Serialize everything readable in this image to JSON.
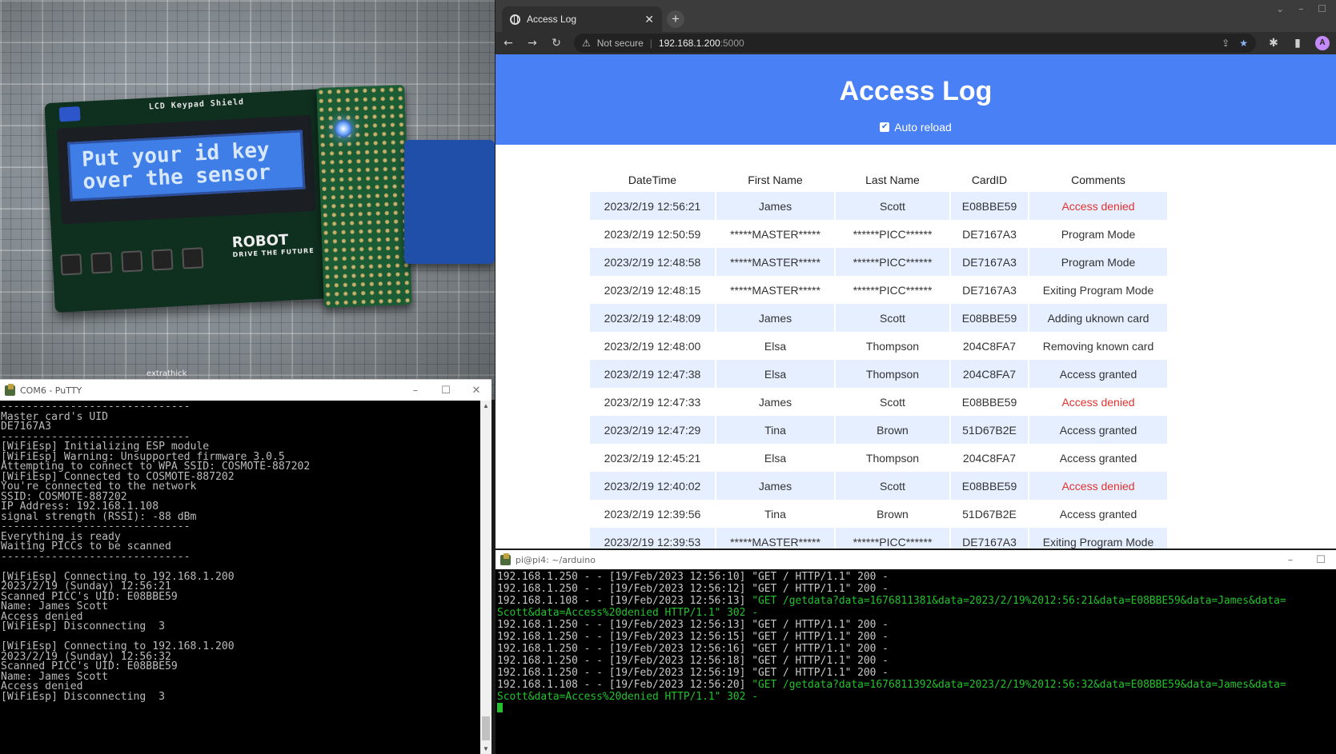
{
  "photo": {
    "lcd_text": "Put your id key\nover the sensor",
    "shield_label": "LCD Keypad Shield",
    "logo_text": "ROBOT",
    "logo_sub": "DRIVE THE FUTURE",
    "caption": "extrathick"
  },
  "putty": {
    "title": "COM6 - PuTTY",
    "controls": {
      "minimize": "–",
      "maximize": "☐",
      "close": "✕"
    },
    "lines": [
      "------------------------------",
      "Master card's UID",
      "DE7167A3",
      "------------------------------",
      "[WiFiEsp] Initializing ESP module",
      "[WiFiEsp] Warning: Unsupported firmware 3.0.5",
      "Attempting to connect to WPA SSID: COSMOTE-887202",
      "[WiFiEsp] Connected to COSMOTE-887202",
      "You're connected to the network",
      "SSID: COSMOTE-887202",
      "IP Address: 192.168.1.108",
      "signal strength (RSSI): -88 dBm",
      "------------------------------",
      "Everything is ready",
      "Waiting PICCs to be scanned",
      "------------------------------",
      "",
      "[WiFiEsp] Connecting to 192.168.1.200",
      "2023/2/19 (Sunday) 12:56:21",
      "Scanned PICC's UID: E08BBE59",
      "Name: James Scott",
      "Access denied",
      "[WiFiEsp] Disconnecting  3",
      "",
      "[WiFiEsp] Connecting to 192.168.1.200",
      "2023/2/19 (Sunday) 12:56:32",
      "Scanned PICC's UID: E08BBE59",
      "Name: James Scott",
      "Access denied",
      "[WiFiEsp] Disconnecting  3"
    ]
  },
  "browser": {
    "tab_title": "Access Log",
    "tab_close": "✕",
    "new_tab": "+",
    "security_label": "Not secure",
    "url_host": "192.168.1.200",
    "url_port": ":5000",
    "avatar_initial": "A",
    "page_title": "Access Log",
    "auto_reload_label": "Auto reload",
    "auto_reload_checked": true,
    "accent_color": "#4a80f5",
    "denied_color": "#e0322d",
    "columns": [
      "DateTime",
      "First Name",
      "Last Name",
      "CardID",
      "Comments"
    ],
    "rows": [
      [
        "2023/2/19 12:56:21",
        "James",
        "Scott",
        "E08BBE59",
        "Access denied"
      ],
      [
        "2023/2/19 12:50:59",
        "*****MASTER*****",
        "******PICC******",
        "DE7167A3",
        "Program Mode"
      ],
      [
        "2023/2/19 12:48:58",
        "*****MASTER*****",
        "******PICC******",
        "DE7167A3",
        "Program Mode"
      ],
      [
        "2023/2/19 12:48:15",
        "*****MASTER*****",
        "******PICC******",
        "DE7167A3",
        "Exiting Program Mode"
      ],
      [
        "2023/2/19 12:48:09",
        "James",
        "Scott",
        "E08BBE59",
        "Adding uknown card"
      ],
      [
        "2023/2/19 12:48:00",
        "Elsa",
        "Thompson",
        "204C8FA7",
        "Removing known card"
      ],
      [
        "2023/2/19 12:47:38",
        "Elsa",
        "Thompson",
        "204C8FA7",
        "Access granted"
      ],
      [
        "2023/2/19 12:47:33",
        "James",
        "Scott",
        "E08BBE59",
        "Access denied"
      ],
      [
        "2023/2/19 12:47:29",
        "Tina",
        "Brown",
        "51D67B2E",
        "Access granted"
      ],
      [
        "2023/2/19 12:45:21",
        "Elsa",
        "Thompson",
        "204C8FA7",
        "Access granted"
      ],
      [
        "2023/2/19 12:40:02",
        "James",
        "Scott",
        "E08BBE59",
        "Access denied"
      ],
      [
        "2023/2/19 12:39:56",
        "Tina",
        "Brown",
        "51D67B2E",
        "Access granted"
      ],
      [
        "2023/2/19 12:39:53",
        "*****MASTER*****",
        "******PICC******",
        "DE7167A3",
        "Exiting Program Mode"
      ]
    ]
  },
  "pi_terminal": {
    "title": "pi@pi4: ~/arduino",
    "lines": [
      [
        "192.168.1.250 - - [19/Feb/2023 12:56:10] ",
        "\"GET / HTTP/1.1\" 200 -",
        ""
      ],
      [
        "192.168.1.250 - - [19/Feb/2023 12:56:12] ",
        "\"GET / HTTP/1.1\" 200 -",
        ""
      ],
      [
        "192.168.1.108 - - [19/Feb/2023 12:56:13] ",
        "",
        "\"GET /getdata?data=1676811381&data=2023/2/19%2012:56:21&data=E08BBE59&data=James&data="
      ],
      [
        "",
        "",
        "Scott&data=Access%20denied HTTP/1.1\" 302 -"
      ],
      [
        "192.168.1.250 - - [19/Feb/2023 12:56:13] ",
        "\"GET / HTTP/1.1\" 200 -",
        ""
      ],
      [
        "192.168.1.250 - - [19/Feb/2023 12:56:15] ",
        "\"GET / HTTP/1.1\" 200 -",
        ""
      ],
      [
        "192.168.1.250 - - [19/Feb/2023 12:56:16] ",
        "\"GET / HTTP/1.1\" 200 -",
        ""
      ],
      [
        "192.168.1.250 - - [19/Feb/2023 12:56:18] ",
        "\"GET / HTTP/1.1\" 200 -",
        ""
      ],
      [
        "192.168.1.250 - - [19/Feb/2023 12:56:19] ",
        "\"GET / HTTP/1.1\" 200 -",
        ""
      ],
      [
        "192.168.1.108 - - [19/Feb/2023 12:56:20] ",
        "",
        "\"GET /getdata?data=1676811392&data=2023/2/19%2012:56:32&data=E08BBE59&data=James&data="
      ],
      [
        "",
        "",
        "Scott&data=Access%20denied HTTP/1.1\" 302 -"
      ]
    ]
  }
}
